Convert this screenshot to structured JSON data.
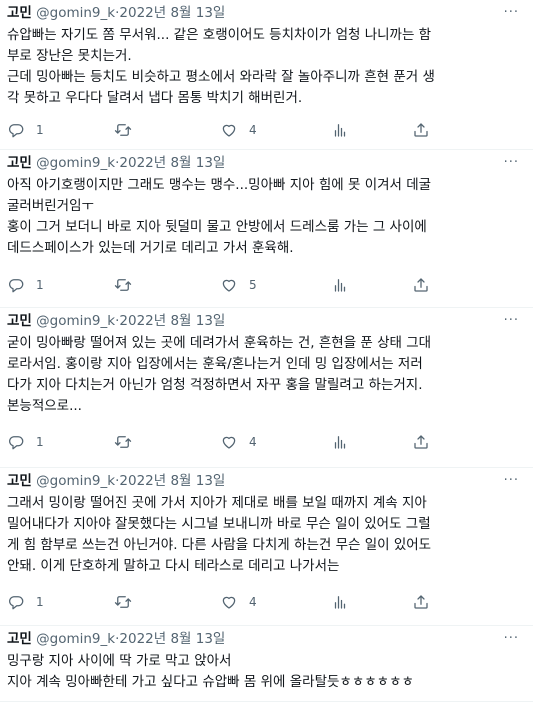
{
  "tweets": [
    {
      "name": "고민",
      "handle": "@gomin9_k",
      "dot": "·",
      "date": "2022년 8월 13일",
      "lines": [
        "슈압빠는 자기도 쫌 무서워... 같은 호랭이어도 등치차이가 엄청 나니까는 함",
        "부로 장난은 못치는거.",
        "근데 밍아빠는 등치도 비슷하고 평소에서 와라락 잘 놀아주니까 흔현 푼거 생",
        "각 못하고 우다다 달려서 냅다 몸통 박치기 해버린거."
      ],
      "replies": "1",
      "retweets": "",
      "likes": "4"
    },
    {
      "name": "고민",
      "handle": "@gomin9_k",
      "dot": "·",
      "date": "2022년 8월 13일",
      "lines": [
        "아직 아기호랭이지만 그래도 맹수는 맹수...밍아빠 지아 힘에 못 이겨서 데굴",
        "굴러버린거임ㅜ",
        "홍이 그거 보더니 바로 지아 뒷덜미 물고 안방에서 드레스룸 가는 그 사이에",
        "데드스페이스가 있는데 거기로 데리고 가서 훈육해."
      ],
      "replies": "1",
      "retweets": "",
      "likes": "5"
    },
    {
      "name": "고민",
      "handle": "@gomin9_k",
      "dot": "·",
      "date": "2022년 8월 13일",
      "lines": [
        "굳이 밍아빠랑 떨어져 있는 곳에 데려가서 훈육하는 건, 흔현을 푼 상태 그대",
        "로라서임. 홍이랑 지아 입장에서는 훈육/혼나는거 인데 밍 입장에서는 저러",
        "다가 지아 다치는거 아닌가 엄청 걱정하면서 자꾸 홍을 말릴려고 하는거지.",
        "본능적으로..."
      ],
      "replies": "1",
      "retweets": "",
      "likes": "4"
    },
    {
      "name": "고민",
      "handle": "@gomin9_k",
      "dot": "·",
      "date": "2022년 8월 13일",
      "lines": [
        "그래서 밍이랑 떨어진 곳에 가서 지아가 제대로 배를 보일 때까지 계속 지아",
        "밀어내다가 지아야 잘못했다는 시그널 보내니까 바로 무슨 일이 있어도 그럴",
        "게 힘 함부로 쓰는건 아닌거야. 다른 사람을 다치게 하는건 무슨 일이 있어도",
        "안돼. 이게 단호하게 말하고 다시 테라스로 데리고 나가서는"
      ],
      "replies": "1",
      "retweets": "",
      "likes": "4"
    },
    {
      "name": "고민",
      "handle": "@gomin9_k",
      "dot": "·",
      "date": "2022년 8월 13일",
      "lines": [
        "밍구랑 지아 사이에 딱 가로 막고 앉아서",
        "지아 계속 밍아빠한테 가고 싶다고 슈압빠 몸 위에 올라탈듯ㅎㅎㅎㅎㅎㅎ"
      ],
      "replies": "",
      "retweets": "",
      "likes": ""
    }
  ],
  "icons": [
    "more-icon",
    "reply-icon",
    "retweet-icon",
    "like-icon",
    "views-icon",
    "share-icon"
  ],
  "colors": {
    "text": "#0f1419",
    "secondary": "#536471",
    "divider": "#eff3f4"
  }
}
